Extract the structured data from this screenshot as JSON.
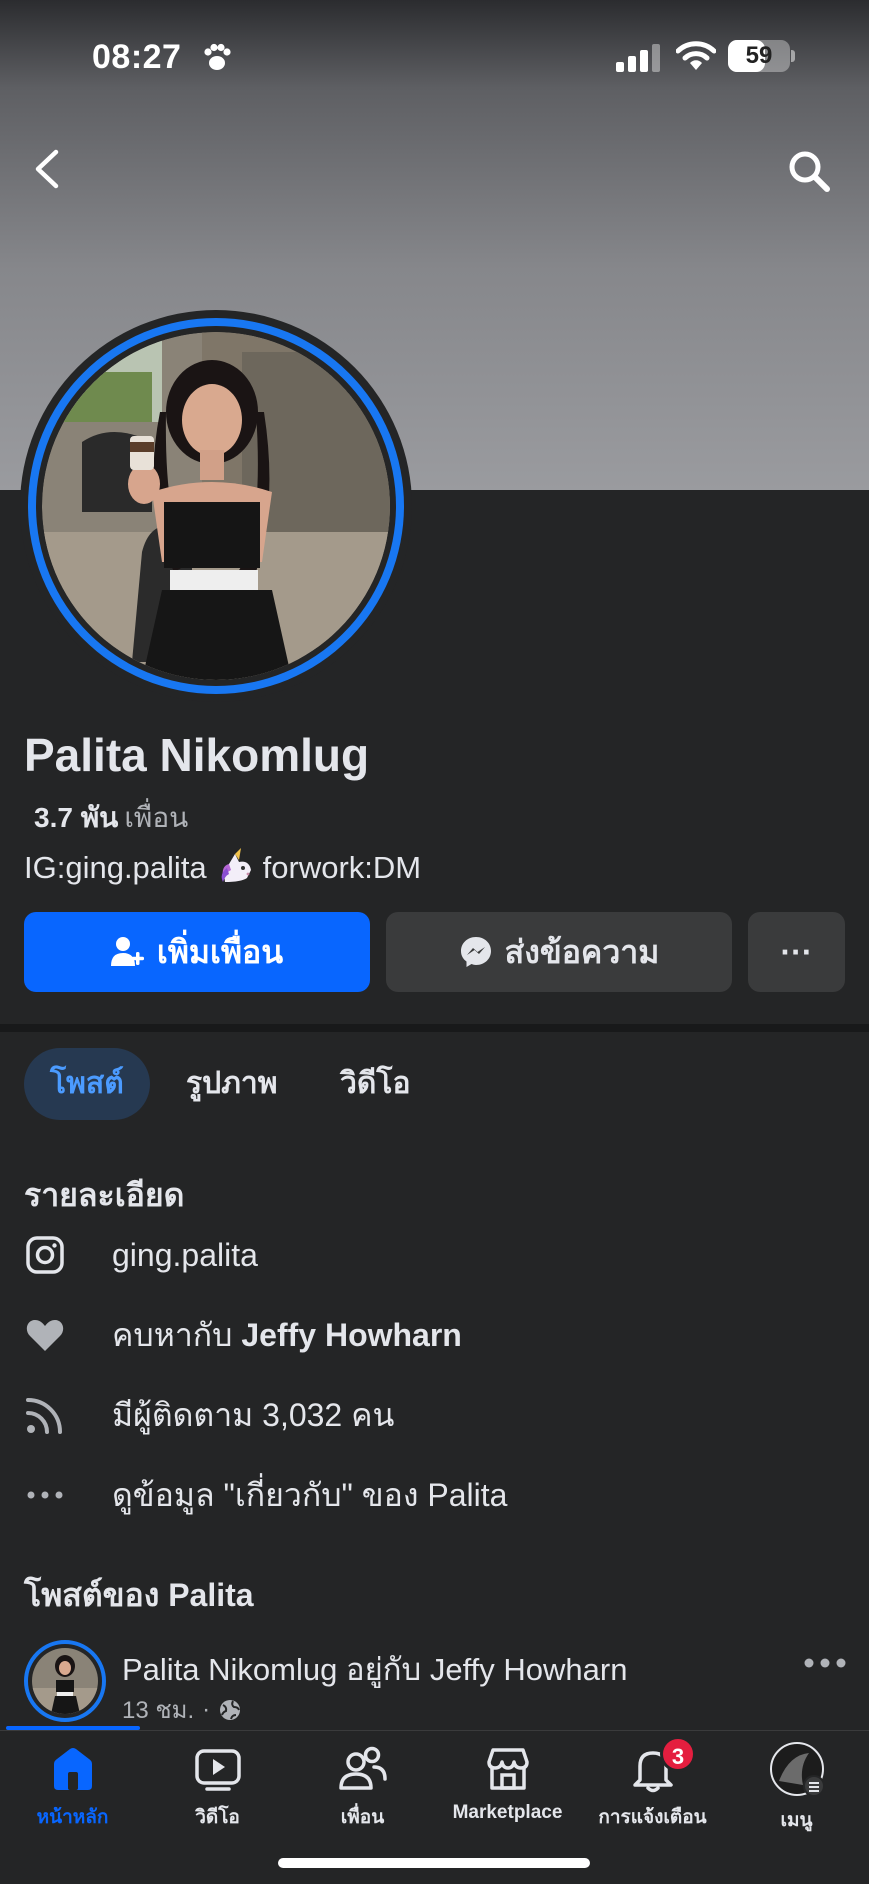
{
  "status_bar": {
    "time": "08:27",
    "battery": "59",
    "battery_level": 0.59
  },
  "profile": {
    "name": "Palita Nikomlug",
    "friends_count": "3.7 พัน",
    "friends_label": "เพื่อน",
    "bio_before": "IG:ging.palita",
    "bio_emoji": "unicorn-emoji",
    "bio_after": "forwork:DM"
  },
  "actions": {
    "add_friend": "เพิ่มเพื่อน",
    "message": "ส่งข้อความ",
    "more": "···"
  },
  "tabs": [
    {
      "label": "โพสต์",
      "active": true
    },
    {
      "label": "รูปภาพ",
      "active": false
    },
    {
      "label": "วิดีโอ",
      "active": false
    }
  ],
  "details": {
    "title": "รายละเอียด",
    "instagram": "ging.palita",
    "relationship_prefix": "คบหากับ",
    "relationship_name": "Jeffy Howharn",
    "followers": "มีผู้ติดตาม 3,032 คน",
    "about": "ดูข้อมูล \"เกี่ยวกับ\" ของ Palita"
  },
  "posts": {
    "title": "โพสต์ของ Palita",
    "author": "Palita Nikomlug",
    "with_label": "อยู่กับ",
    "with_name": "Jeffy Howharn",
    "time": "13 ชม.",
    "separator": "·",
    "privacy_icon": "globe-icon"
  },
  "nav": {
    "home": "หน้าหลัก",
    "video": "วิดีโอ",
    "friends": "เพื่อน",
    "marketplace": "Marketplace",
    "notifications": "การแจ้งเตือน",
    "notifications_badge": "3",
    "menu": "เมนู"
  },
  "colors": {
    "background": "#242526",
    "accent": "#0866ff",
    "secondary_button": "#3a3b3c",
    "badge": "#e41e3f"
  }
}
